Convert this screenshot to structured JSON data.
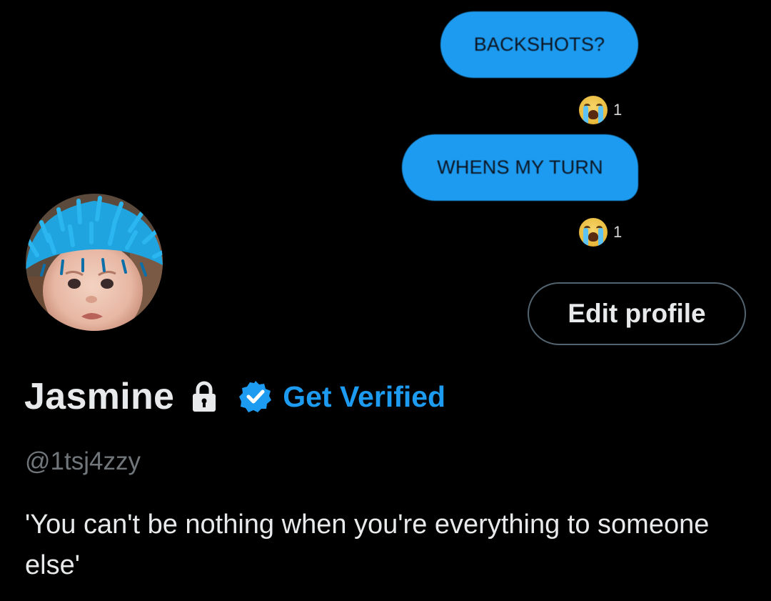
{
  "header_image": {
    "messages": [
      {
        "text": "BACKSHOTS?",
        "reaction_emoji": "loudly-crying-face-emoji",
        "reaction_count": "1"
      },
      {
        "text": "WHENS MY TURN",
        "reaction_emoji": "loudly-crying-face-emoji",
        "reaction_count": "1"
      }
    ],
    "bubble_color": "#1d9bf0"
  },
  "profile": {
    "avatar_icon": "avatar-photo",
    "display_name": "Jasmine",
    "lock_icon": "lock-icon",
    "verified_icon": "verified-badge-icon",
    "get_verified_label": "Get Verified",
    "handle": "@1tsj4zzy",
    "bio": "'You can't be nothing when you're everything to someone else'"
  },
  "actions": {
    "edit_profile_label": "Edit profile"
  },
  "colors": {
    "background": "#000000",
    "primary_text": "#e7e9ea",
    "secondary_text": "#71767b",
    "accent": "#1d9bf0",
    "button_border": "#536471"
  }
}
